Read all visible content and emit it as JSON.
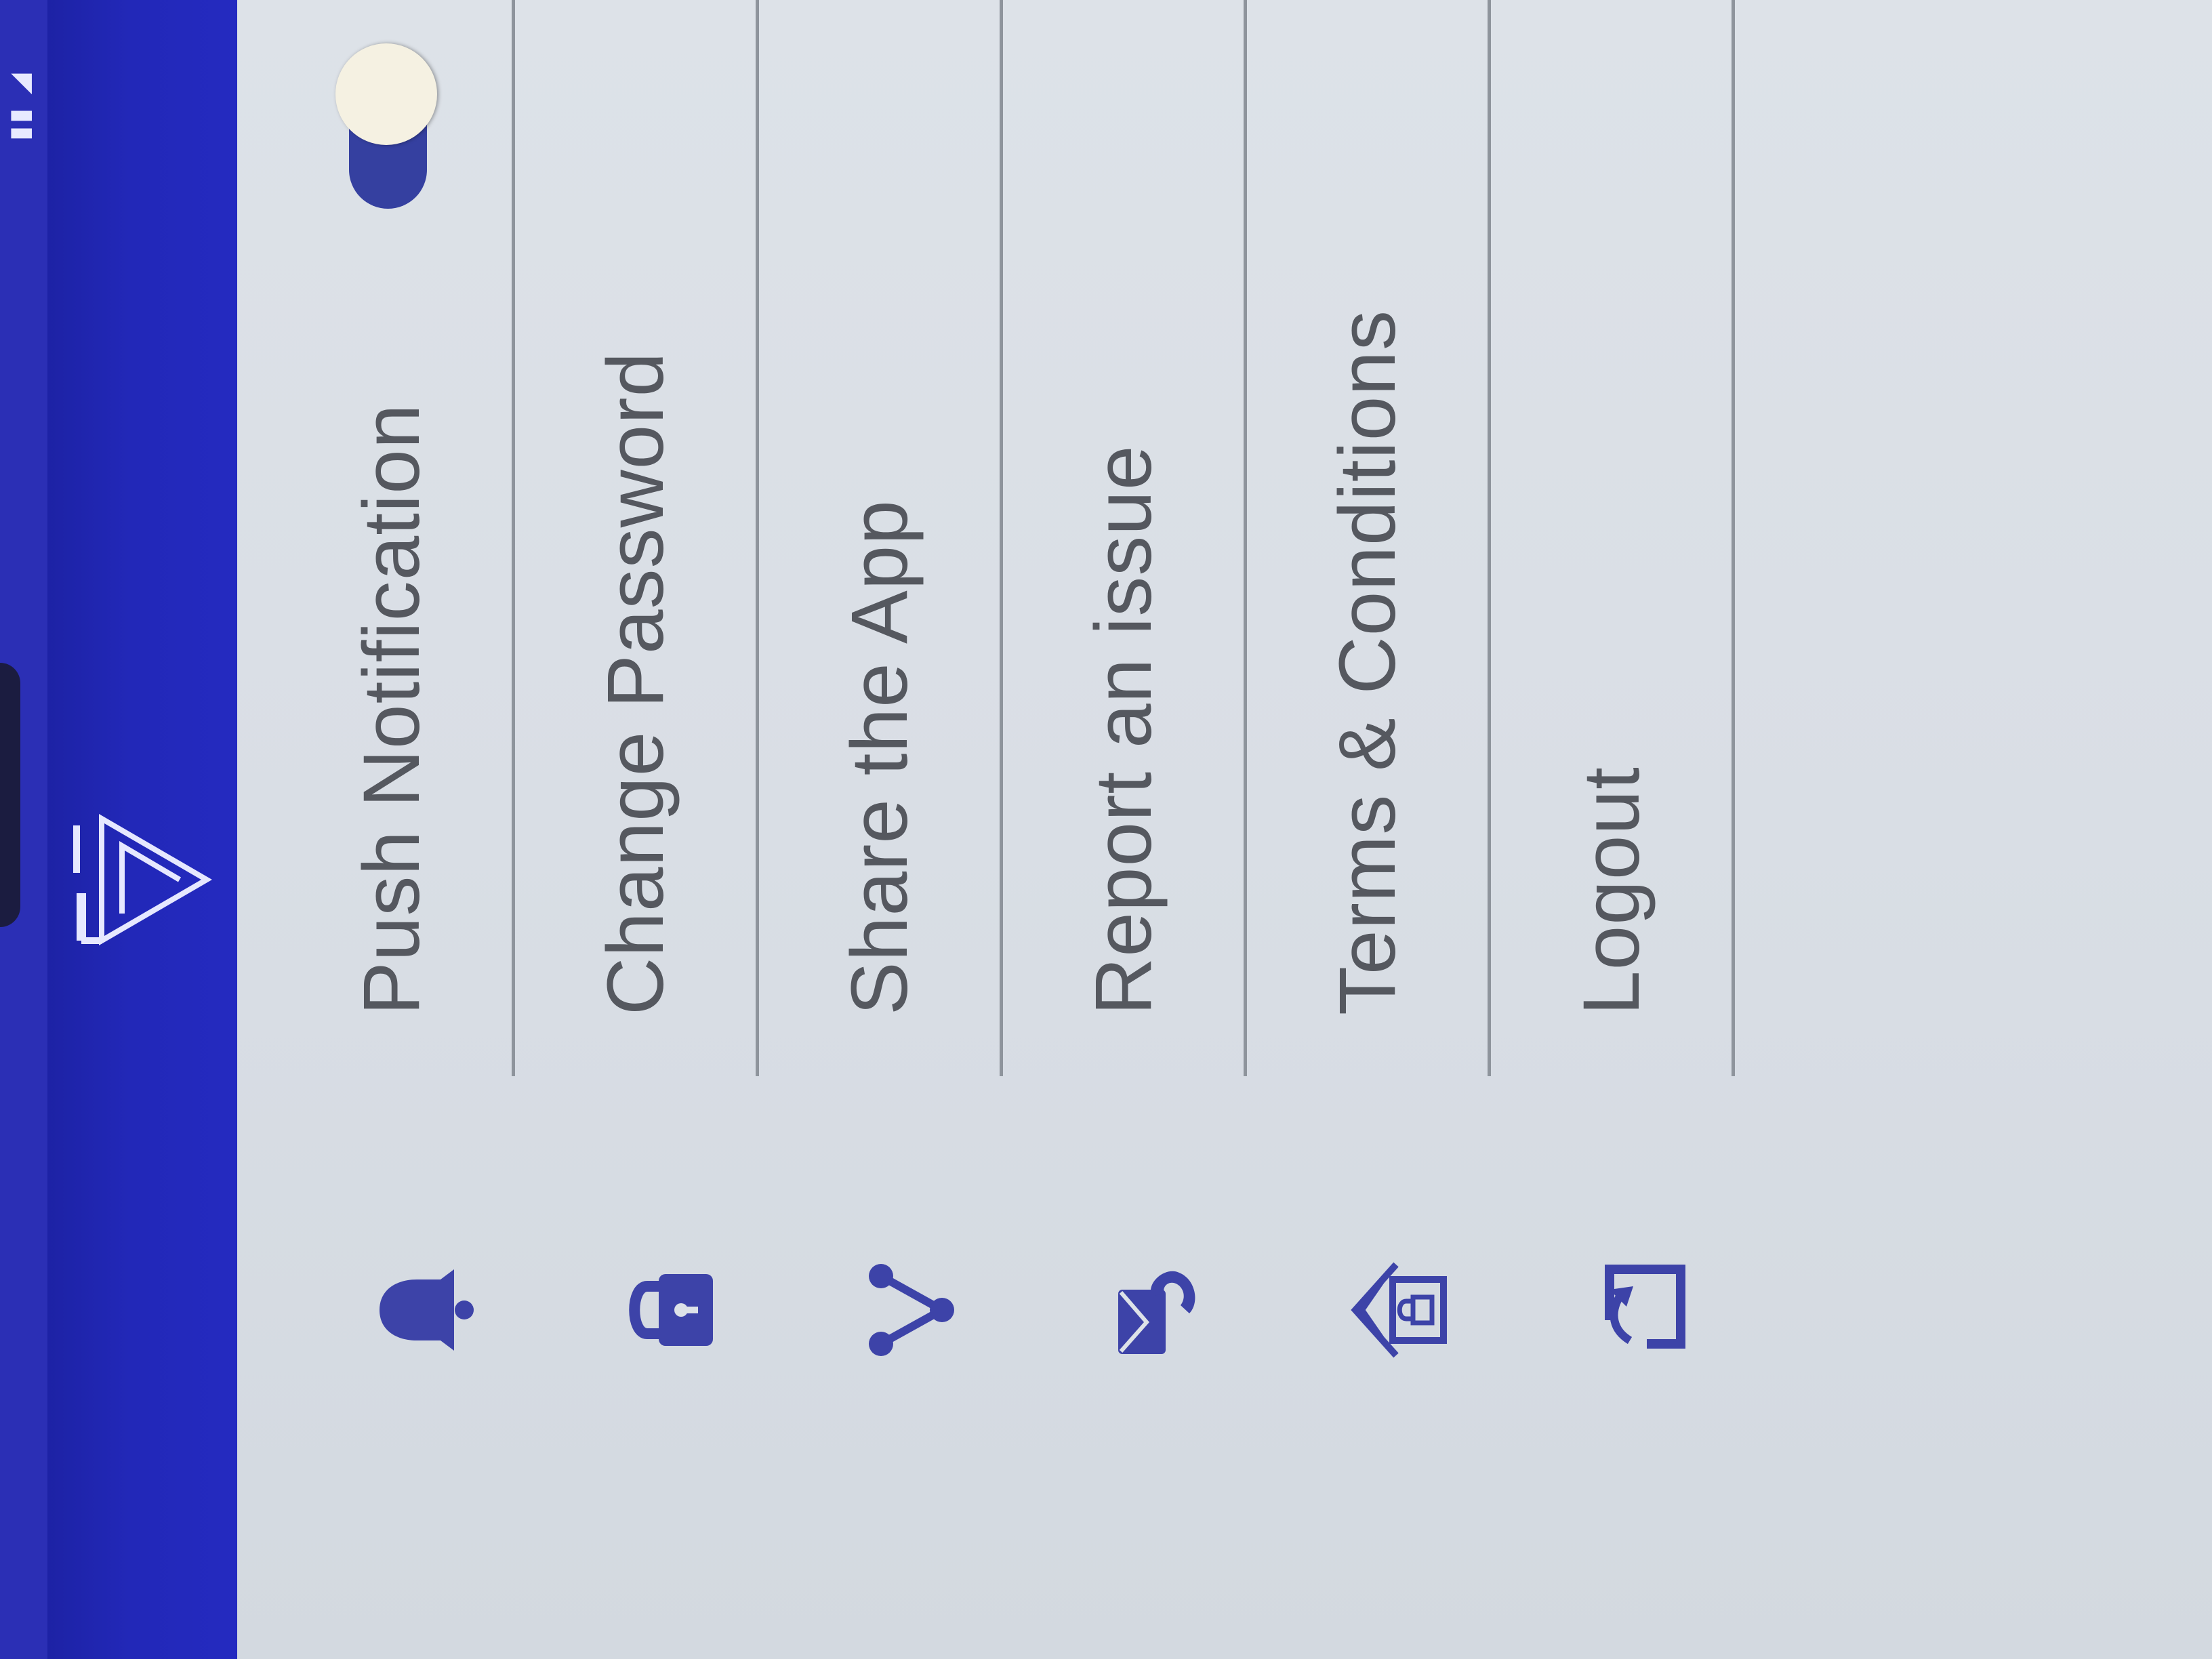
{
  "status_bar": {
    "icons": "▮▮ ◢"
  },
  "header": {
    "logo_name": "app-logo",
    "background_color": "#2228b8"
  },
  "menu": {
    "items": [
      {
        "label": "Push Notification",
        "icon": "bell-icon"
      },
      {
        "label": "Change Password",
        "icon": "lock-icon"
      },
      {
        "label": "Share the App",
        "icon": "share-icon"
      },
      {
        "label": "Report an issue",
        "icon": "mail-phone-icon"
      },
      {
        "label": "Terms & Conditions",
        "icon": "house-lock-icon"
      },
      {
        "label": "Logout",
        "icon": "logout-icon"
      }
    ]
  },
  "push_toggle": {
    "state": "on",
    "track_color": "#3540a0",
    "knob_color": "#f5f1e2"
  },
  "colors": {
    "accent": "#3d43a8",
    "text": "#55585f",
    "divider": "#8e949c"
  }
}
